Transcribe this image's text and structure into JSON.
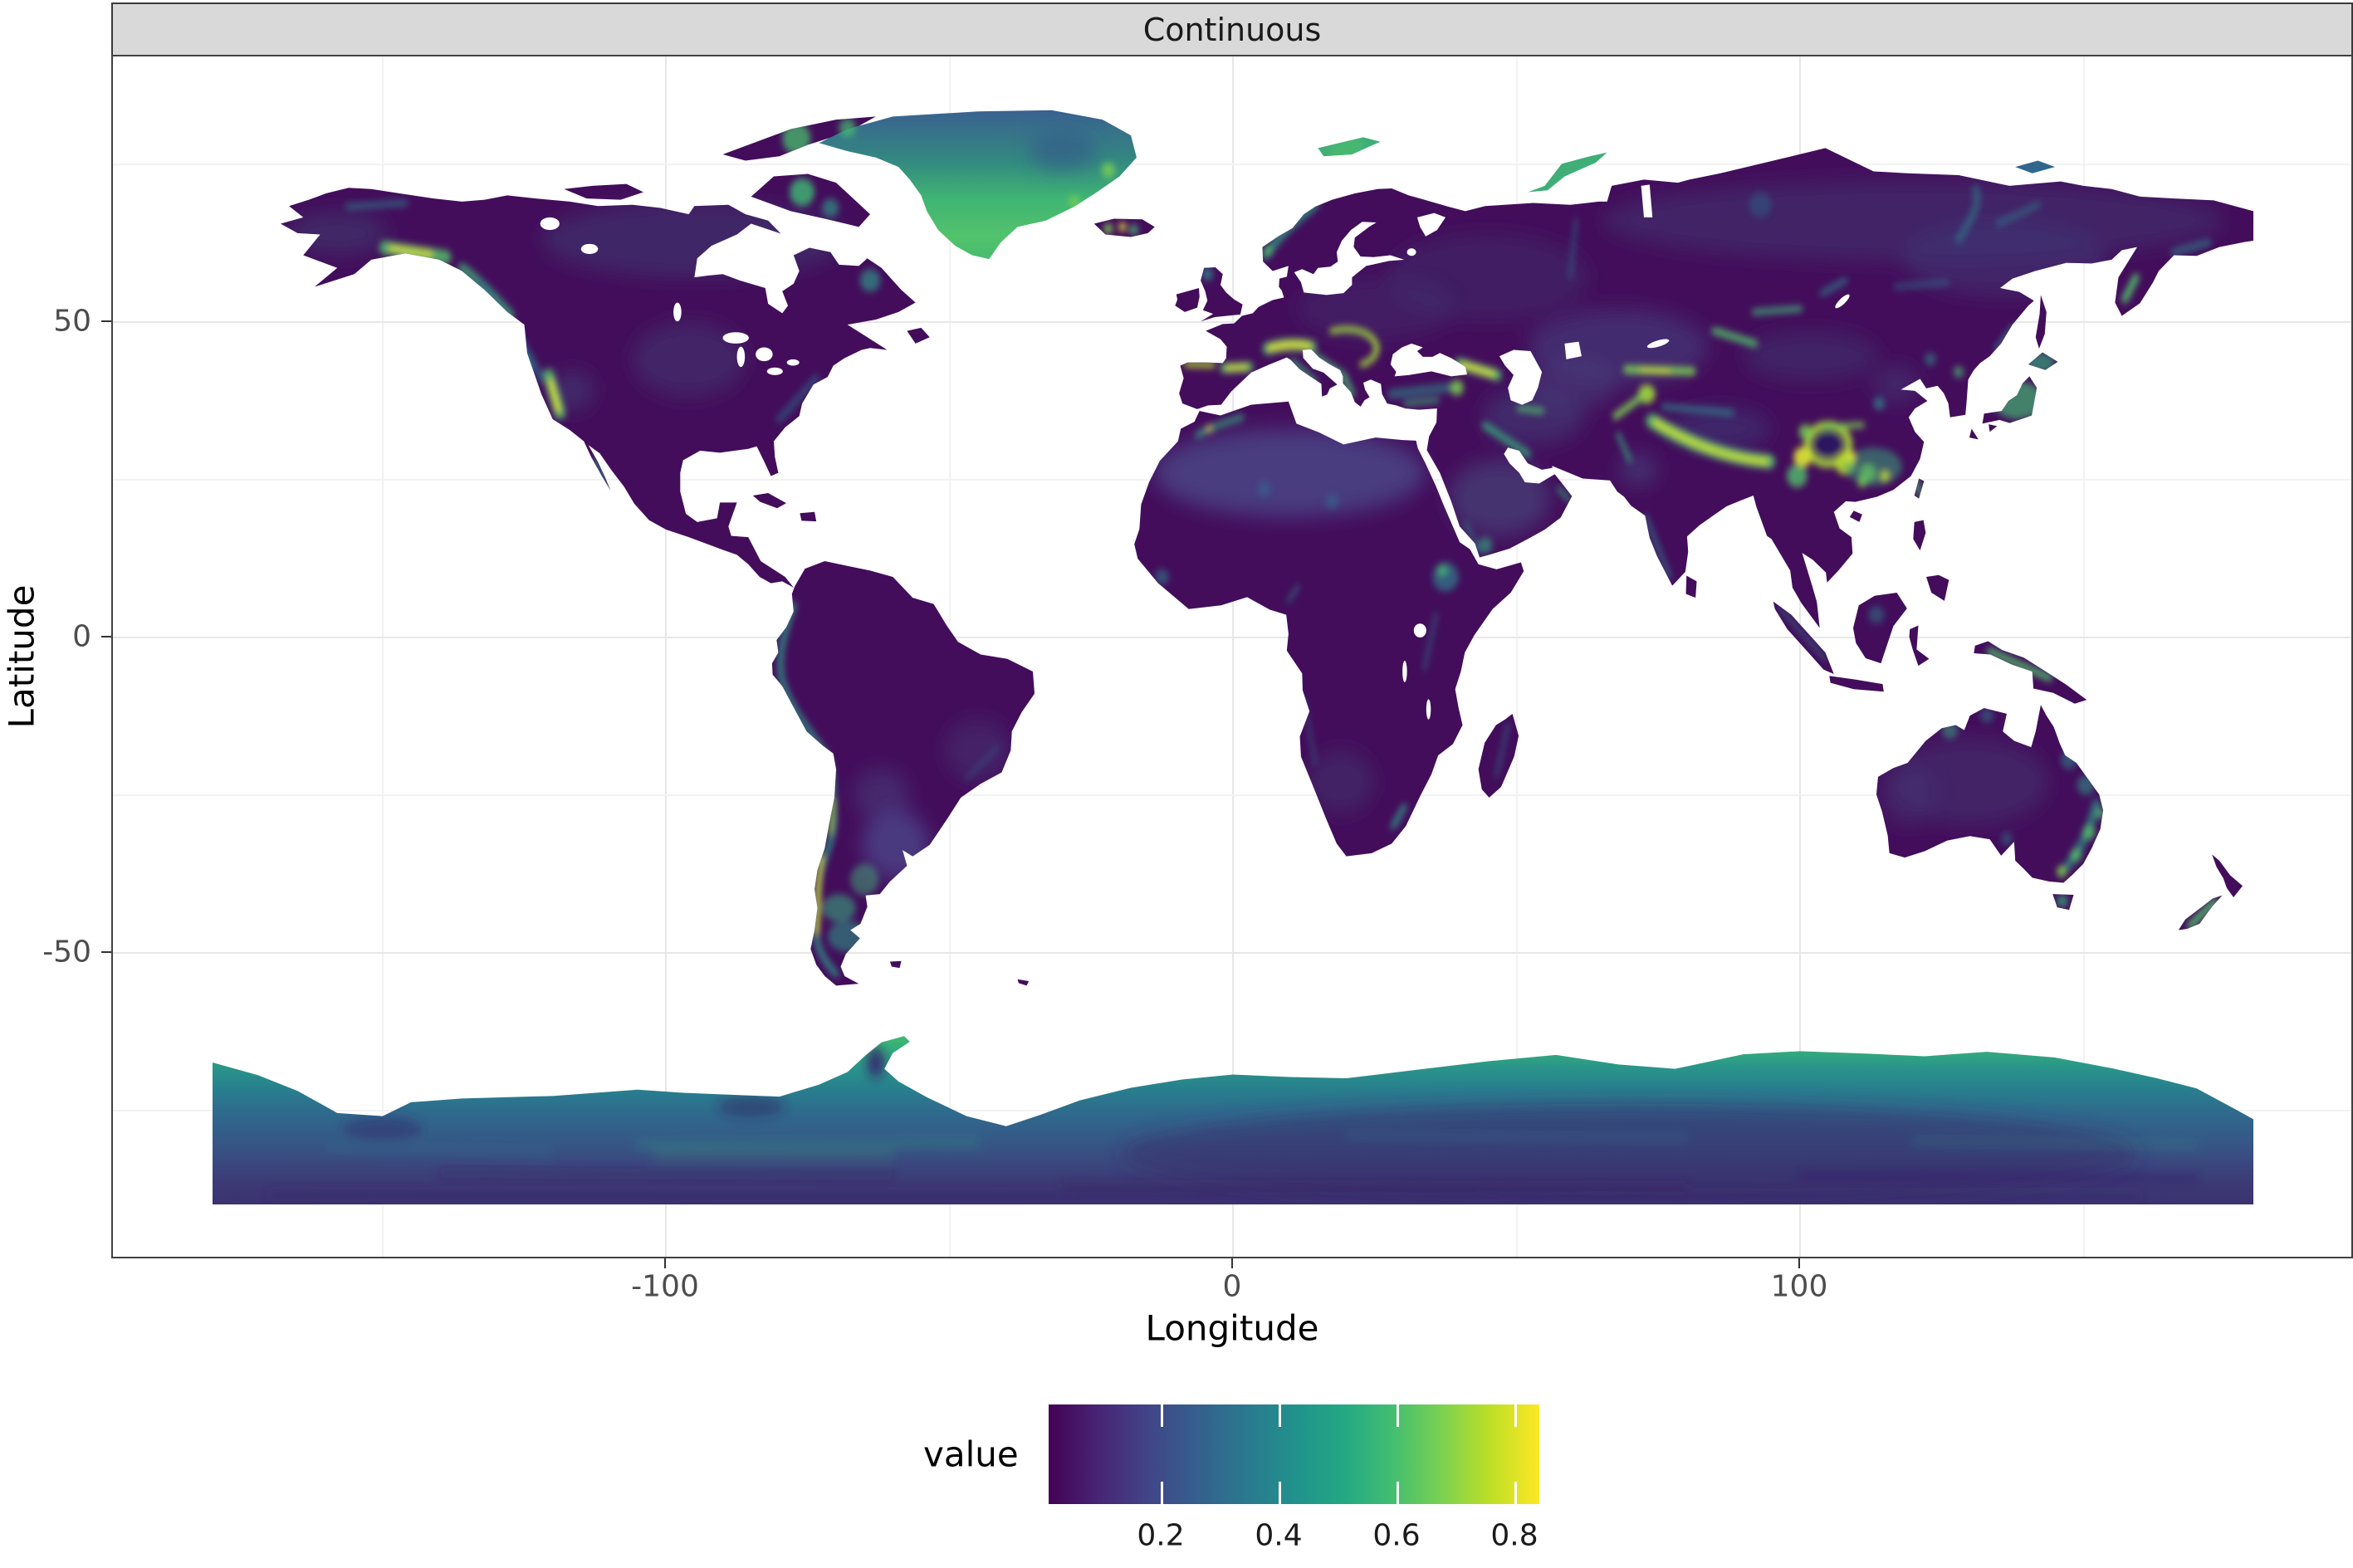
{
  "strip": {
    "title": "Continuous"
  },
  "axes": {
    "x": {
      "title": "Longitude",
      "tick_labels": [
        "-100",
        "0",
        "100"
      ]
    },
    "y": {
      "title": "Latitude",
      "tick_labels": [
        "50",
        "0",
        "-50"
      ]
    }
  },
  "legend": {
    "title": "value",
    "tick_labels": [
      "0.2",
      "0.4",
      "0.6",
      "0.8"
    ]
  },
  "colors": {
    "ocean": "#ffffff",
    "strip_background": "#d9d9d9",
    "panel_border": "#404040",
    "grid_major": "#e7e7e7",
    "grid_minor": "#f2f2f2",
    "tick_text": "#4d4d4d",
    "text": "#1a1a1a",
    "land_low_value": "#430d5b",
    "viridis_stops": [
      "#440154",
      "#482475",
      "#414487",
      "#355f8d",
      "#2a788e",
      "#21918c",
      "#22a884",
      "#42be71",
      "#7ad151",
      "#bddf26",
      "#fde725"
    ]
  },
  "chart_data": {
    "type": "heatmap",
    "subtype": "world-raster-map",
    "facet_label": "Continuous",
    "xlabel": "Longitude",
    "ylabel": "Latitude",
    "xlim": [
      -180,
      180
    ],
    "ylim": [
      -90,
      83.6
    ],
    "x_major_ticks": [
      -100,
      0,
      100
    ],
    "x_minor_gridlines": [
      -150,
      -50,
      50,
      150
    ],
    "y_major_ticks": [
      50,
      0,
      -50
    ],
    "y_minor_gridlines": [
      75,
      25,
      -25,
      -75
    ],
    "grid": "major and minor light-grey gridlines on white panel; raster drawn over gridlines",
    "legend": {
      "title": "value",
      "orientation": "horizontal colourbar",
      "position": "bottom center",
      "tick_labels": [
        0.2,
        0.4,
        0.6,
        0.8
      ],
      "approx_value_range": [
        0.01,
        0.85
      ],
      "palette": "viridis (dark purple low to yellow high)"
    },
    "value_semantics": "continuous surface (terrain-ruggedness-like); most lowland continental area 0.02-0.2 (dark purple/indigo), deserts and steppes ~0.15-0.25 (lighter indigo/slate), mountain belts 0.5-0.9 (teal, green, yellow); ice sheets high",
    "high_value_regions": [
      "Greenland ice sheet (green, steel-blue north rim)",
      "Antarctica coastal band (green) grading to dark blue-purple interior toward 90S",
      "Antarctic Peninsula rim",
      "Alps (yellow-green)",
      "Carpathians",
      "Pyrenees and Cantabrian Mountains",
      "Caucasus (yellow)",
      "Anatolia and Zagros (teal-green)",
      "Scandinavian mountains (teal)",
      "Iceland specks (green/yellow)",
      "Himalaya arc and eastern Tibetan margin (bright yellow-green ring around Sichuan)",
      "Southeast China uplands (green/yellow speckle)",
      "Tien Shan, Pamir, Hindu Kush",
      "Altai and Sayan",
      "Alaska and Wrangell-St Elias ranges (yellow-green streak)",
      "Coast Mountains and Rockies (teal)",
      "Sierra Nevada (bright yellow sliver)",
      "Southern Andes and Patagonia (yellow/green streaks)",
      "Great Dividing Range of eastern Australia (teal-green speckle)",
      "Japan (green)",
      "New Zealand Southern Alps (green)",
      "New Guinea highlands",
      "Kamchatka",
      "Baffin Island / Labrador / Ellesmere patches",
      "Svalbard and Novaya Zemlya (green)"
    ],
    "low_value_regions": [
      "Amazon basin (darkest purple)",
      "Congo basin",
      "Sahara and Arabia (slightly lighter indigo)",
      "Siberian and Canadian lowlands (dark with slate patches)",
      "Australian interior",
      "India peninsula",
      "Eastern Europe / Russian plain"
    ]
  }
}
